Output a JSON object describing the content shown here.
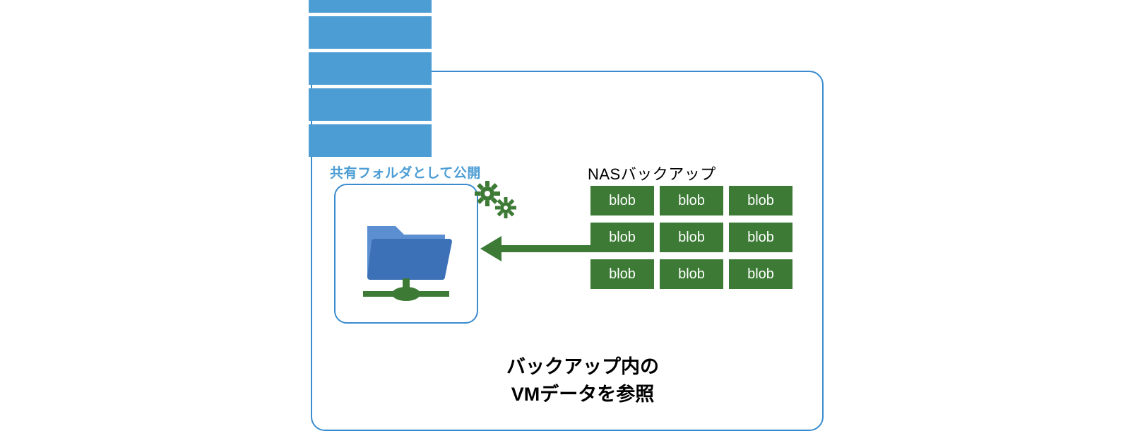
{
  "labels": {
    "shared_folder": "共有フォルダとして公開",
    "nas_backup": "NASバックアップ",
    "caption_line1": "バックアップ内の",
    "caption_line2": "VMデータを参照"
  },
  "blobs": [
    "blob",
    "blob",
    "blob",
    "blob",
    "blob",
    "blob",
    "blob",
    "blob",
    "blob"
  ],
  "colors": {
    "server_blue": "#4c9dd4",
    "border_blue": "#3a8ccf",
    "blob_green": "#3c7a35",
    "arrow_green": "#3c7a35",
    "folder_blue": "#3c71b7",
    "icon_green": "#3c7a35"
  }
}
